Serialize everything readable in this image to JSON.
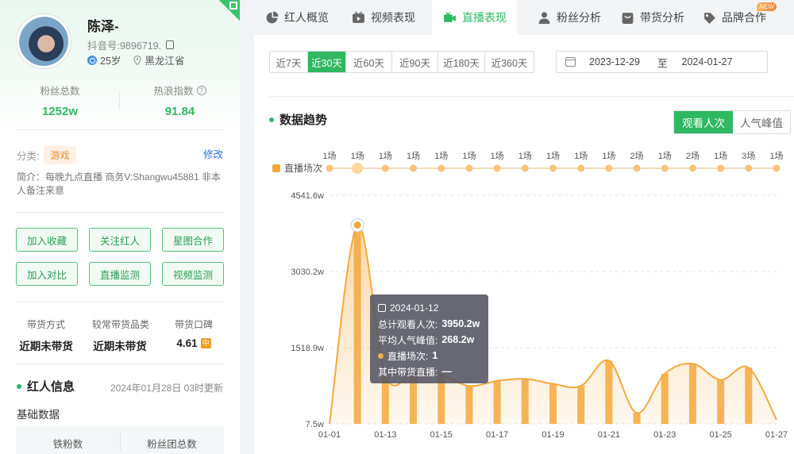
{
  "profile": {
    "name": "陈泽-",
    "douyin_id": "抖音号:9896719.",
    "age": "25岁",
    "location": "黑龙江省",
    "fans_label": "粉丝总数",
    "fans_value": "1252w",
    "heat_label": "热浪指数",
    "heat_value": "91.84",
    "category_label": "分类:",
    "category": "游戏",
    "edit": "修改",
    "intro": "简介：每晚九点直播 商务V:Shangwu45881 非本人备注来意",
    "buttons": [
      "加入收藏",
      "关注红人",
      "星图合作",
      "加入对比",
      "直播监测",
      "视频监测"
    ],
    "cargo": [
      {
        "title": "带货方式",
        "value": "近期未带货"
      },
      {
        "title": "较常带货品类",
        "value": "近期未带货"
      },
      {
        "title": "带货口碑",
        "value": "4.61",
        "badge": "中"
      }
    ],
    "info_title": "红人信息",
    "update_time": "2024年01月28日 03时更新",
    "basic_title": "基础数据",
    "fan_cols": [
      "铁粉数",
      "粉丝团总数"
    ]
  },
  "tabs": [
    {
      "label": "红人概览",
      "icon": "pie-chart-icon",
      "active": false
    },
    {
      "label": "视频表现",
      "icon": "video-icon",
      "active": false
    },
    {
      "label": "直播表现",
      "icon": "live-camera-icon",
      "active": true
    },
    {
      "label": "粉丝分析",
      "icon": "user-icon",
      "active": false
    },
    {
      "label": "带货分析",
      "icon": "shopping-bag-icon",
      "active": false
    },
    {
      "label": "品牌合作",
      "icon": "brand-icon",
      "active": false,
      "badge": "NEW"
    }
  ],
  "ranges": [
    "近7天",
    "近30天",
    "近60天",
    "近90天",
    "近180天",
    "近360天"
  ],
  "selected_range": "近30天",
  "date_from": "2023-12-29",
  "date_sep": "至",
  "date_to": "2024-01-27",
  "trend_title": "数据趋势",
  "toggle": [
    "观看人次",
    "人气峰值"
  ],
  "toggle_active": "观看人次",
  "colors": {
    "accent": "#2fb860",
    "orange": "#f5a83c"
  },
  "chart_data": {
    "type": "area",
    "series_label": "直播场次",
    "y_ticks": [
      "4541.6w",
      "3030.2w",
      "1518.9w",
      "7.5w"
    ],
    "ylim": [
      7.5,
      4541.6
    ],
    "x_ticks": [
      "01-01",
      "01-13",
      "01-15",
      "01-17",
      "01-19",
      "01-21",
      "01-23",
      "01-25",
      "01-27"
    ],
    "sessions": [
      "1场",
      "1场",
      "1场",
      "1场",
      "1场",
      "1场",
      "1场",
      "1场",
      "1场",
      "1场",
      "1场",
      "2场",
      "1场",
      "2场",
      "1场",
      "3场",
      "1场"
    ],
    "values": [
      7.5,
      3950.2,
      980,
      1000,
      980,
      760,
      860,
      900,
      800,
      760,
      1260,
      220,
      1000,
      1200,
      880,
      1120,
      90
    ],
    "tooltip": {
      "date": "2024-01-12",
      "total_label": "总计观看人次:",
      "total": "3950.2w",
      "peak_label": "平均人气峰值:",
      "peak": "268.2w",
      "sessions_label": "直播场次:",
      "sessions": "1",
      "cargo_label": "其中带货直播:",
      "cargo": "—"
    }
  }
}
